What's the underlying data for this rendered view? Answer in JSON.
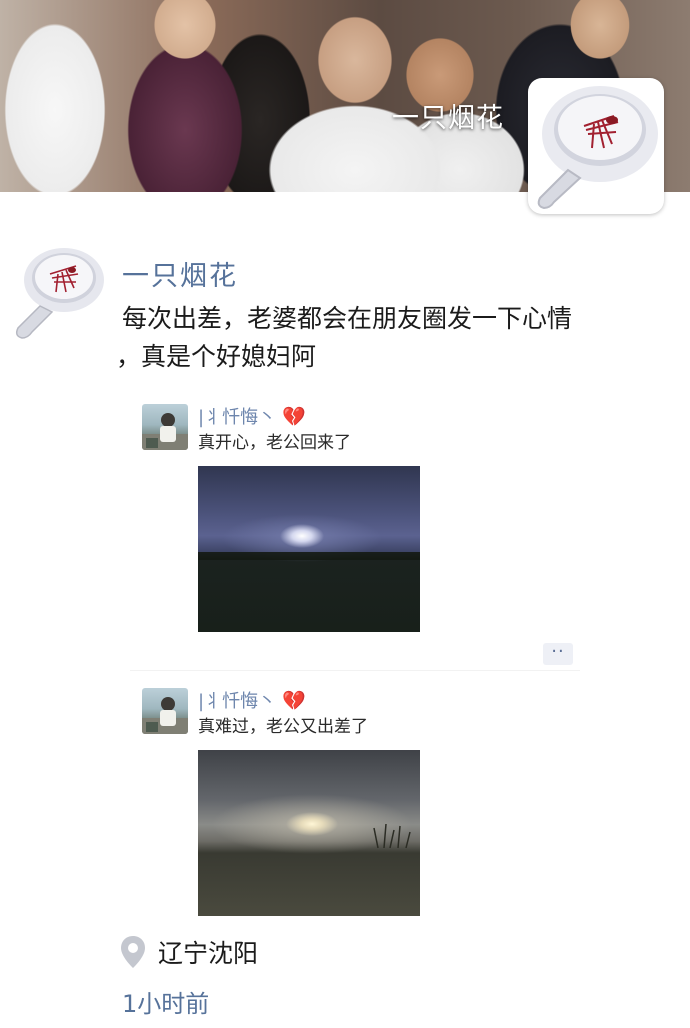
{
  "cover": {
    "name": "一只烟花"
  },
  "post": {
    "author": "一只烟花",
    "text_line1": "每次出差，老婆都会在朋友圈发一下心情",
    "text_line2": "，真是个好媳妇阿"
  },
  "shared_posts": [
    {
      "author": "|丬忏悔丶",
      "heart": "💔",
      "text": "真开心，老公回来了",
      "photo_icon": "moonlit-sky-photo"
    },
    {
      "author": "|丬忏悔丶",
      "heart": "💔",
      "text": "真难过，老公又出差了",
      "photo_icon": "cloudy-sky-photo"
    }
  ],
  "more_button": "··",
  "location": {
    "label": "辽宁沈阳",
    "icon": "location-pin-icon"
  },
  "time_ago": "1小时前",
  "colors": {
    "link_blue": "#56729a",
    "text": "#1b1b1b",
    "heart_red": "#c8233c"
  }
}
